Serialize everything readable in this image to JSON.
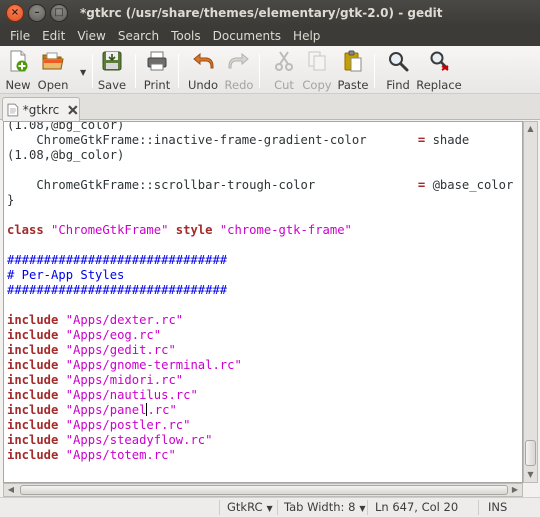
{
  "window": {
    "title": "*gtkrc (/usr/share/themes/elementary/gtk-2.0) - gedit",
    "close_glyph": "×",
    "minimize_glyph": "–",
    "maximize_glyph": "□"
  },
  "menu": [
    "File",
    "Edit",
    "View",
    "Search",
    "Tools",
    "Documents",
    "Help"
  ],
  "toolbar": {
    "new": "New",
    "open": "Open",
    "save": "Save",
    "print": "Print",
    "undo": "Undo",
    "redo": "Redo",
    "cut": "Cut",
    "copy": "Copy",
    "paste": "Paste",
    "find": "Find",
    "replace": "Replace",
    "open_dropdown_glyph": "▼"
  },
  "tab": {
    "name": "*gtkrc"
  },
  "editor": {
    "lines": [
      {
        "a": "(1.08,@bg_color)"
      },
      {
        "a": "    ChromeGtkFrame::inactive-frame-gradient-color       ",
        "op": "=",
        "b": " shade"
      },
      {
        "a": "(1.08,@bg_color)"
      },
      {
        "a": ""
      },
      {
        "a": "    ChromeGtkFrame::scrollbar-trough-color              ",
        "op": "=",
        "b": " @base_color"
      },
      {
        "a": "}"
      },
      {
        "a": ""
      },
      {
        "kw1": "class",
        "s1": "\"ChromeGtkFrame\"",
        "kw2": "style",
        "s2": "\"chrome-gtk-frame\""
      },
      {
        "a": ""
      },
      {
        "c": "##############################"
      },
      {
        "c": "# Per-App Styles"
      },
      {
        "c": "##############################"
      },
      {
        "a": ""
      },
      {
        "kw1": "include",
        "s1": "\"Apps/dexter.rc\""
      },
      {
        "kw1": "include",
        "s1": "\"Apps/eog.rc\""
      },
      {
        "kw1": "include",
        "s1": "\"Apps/gedit.rc\""
      },
      {
        "kw1": "include",
        "s1": "\"Apps/gnome-terminal.rc\""
      },
      {
        "kw1": "include",
        "s1": "\"Apps/midori.rc\""
      },
      {
        "kw1": "include",
        "s1": "\"Apps/nautilus.rc\""
      },
      {
        "kw1": "include",
        "s1": "\"Apps/panel",
        "caret": true,
        "s1b": ".rc\""
      },
      {
        "kw1": "include",
        "s1": "\"Apps/postler.rc\""
      },
      {
        "kw1": "include",
        "s1": "\"Apps/steadyflow.rc\""
      },
      {
        "kw1": "include",
        "s1": "\"Apps/totem.rc\""
      }
    ]
  },
  "status": {
    "language": "GtkRC",
    "tab_width": "Tab Width:  8",
    "position": "Ln 647, Col 20",
    "mode": "INS",
    "chevron": "▼"
  },
  "colors": {
    "keyword": "#a52a2a",
    "string": "#cc00cc",
    "comment": "#0000ee",
    "close_button": "#e0501e"
  }
}
